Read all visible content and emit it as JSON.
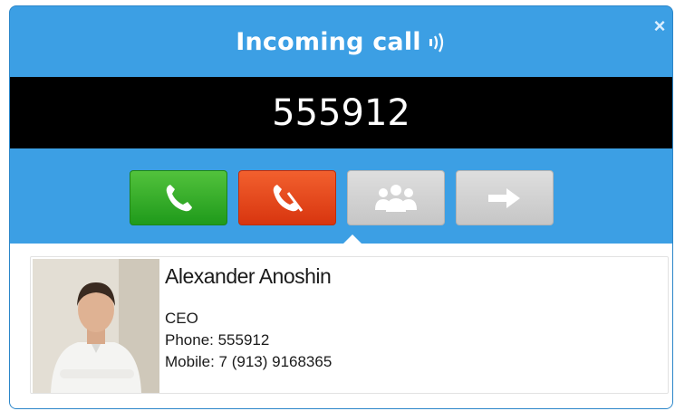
{
  "window": {
    "title": "Incoming call",
    "close_label": "×"
  },
  "call": {
    "number": "555912"
  },
  "actions": [
    {
      "name": "answer",
      "icon": "phone-icon",
      "color": "#2fa82a"
    },
    {
      "name": "decline",
      "icon": "hangup-icon",
      "color": "#e2451b"
    },
    {
      "name": "conference",
      "icon": "group-icon",
      "color": "#d2d2d2"
    },
    {
      "name": "transfer",
      "icon": "arrow-right-icon",
      "color": "#d2d2d2"
    }
  ],
  "contact": {
    "name": "Alexander Anoshin",
    "title": "CEO",
    "phone": "Phone: 555912",
    "mobile": "Mobile: 7 (913) 9168365"
  },
  "colors": {
    "window": "#3c9fe4",
    "number_bar": "#000000"
  }
}
